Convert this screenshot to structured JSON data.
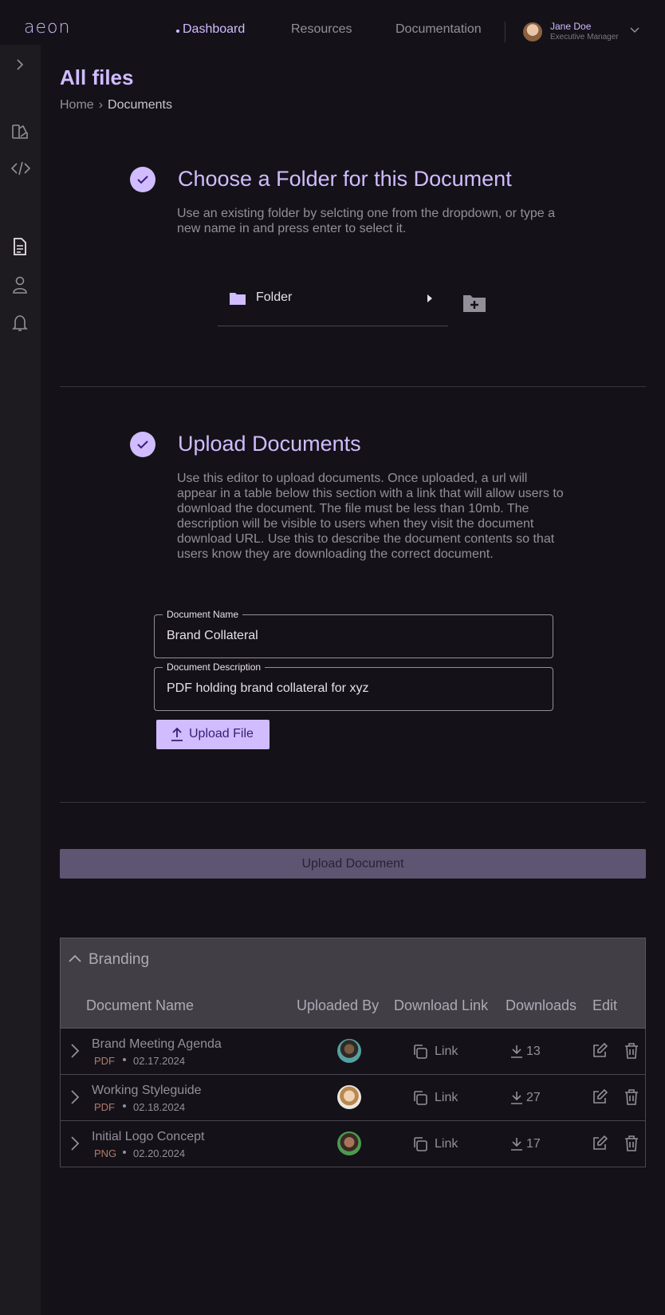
{
  "app": {
    "logo": "aeon"
  },
  "nav": {
    "dashboard": "Dashboard",
    "resources": "Resources",
    "documentation": "Documentation"
  },
  "user": {
    "name": "Jane Doe",
    "role": "Executive Manager"
  },
  "page": {
    "title": "All files",
    "breadcrumb": {
      "home": "Home",
      "current": "Documents"
    }
  },
  "folder_section": {
    "title": "Choose a Folder for this Document",
    "description": "Use an existing folder by selcting one from the dropdown, or type a new name in and press enter to select it.",
    "select_label": "Folder"
  },
  "upload_section": {
    "title": "Upload Documents",
    "description": "Use this editor to upload documents. Once uploaded, a url will appear in a table below this section with a link that will allow users to download the document. The file must be less than 10mb. The description will be visible to users when they visit the document download URL. Use this to describe the document contents so that users know they are downloading the correct document.",
    "name_field": {
      "label": "Document Name",
      "value": "Brand Collateral"
    },
    "desc_field": {
      "label": "Document Description",
      "value": "PDF holding brand collateral for xyz"
    },
    "upload_file_label": "Upload File"
  },
  "upload_document_label": "Upload Document",
  "table": {
    "group": "Branding",
    "headers": {
      "name": "Document Name",
      "uploaded_by": "Uploaded By",
      "download_link": "Download Link",
      "downloads": "Downloads",
      "edit": "Edit"
    },
    "rows": [
      {
        "name": "Brand Meeting Agenda",
        "type": "PDF",
        "date": "02.17.2024",
        "link": "Link",
        "downloads": "13"
      },
      {
        "name": "Working Styleguide",
        "type": "PDF",
        "date": "02.18.2024",
        "link": "Link",
        "downloads": "27"
      },
      {
        "name": "Initial Logo Concept",
        "type": "PNG",
        "date": "02.20.2024",
        "link": "Link",
        "downloads": "17"
      }
    ]
  },
  "colors": {
    "accent": "#d0bcff",
    "background": "#141218",
    "sidebar": "#1d1b20"
  }
}
